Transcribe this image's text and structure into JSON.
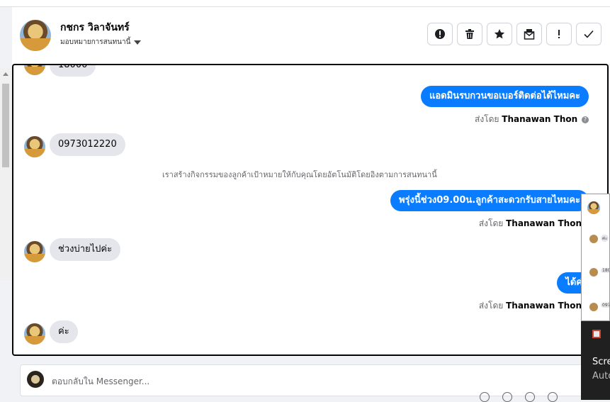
{
  "header": {
    "contact_name": "กชกร วิลาจันทร์",
    "assign_label": "มอบหมายการสนทนานี้",
    "actions": [
      {
        "name": "report-button",
        "icon": "alert-circle-icon"
      },
      {
        "name": "delete-button",
        "icon": "trash-icon"
      },
      {
        "name": "star-button",
        "icon": "star-icon"
      },
      {
        "name": "mark-unread-button",
        "icon": "envelope-icon"
      },
      {
        "name": "priority-button",
        "icon": "exclamation-icon"
      },
      {
        "name": "done-button",
        "icon": "checkmark-icon"
      }
    ]
  },
  "messages": {
    "partial_top": "18000",
    "out_1": "แอดมินรบกวนขอเบอร์ติดต่อได้ไหมคะ",
    "in_1": "0973012220",
    "system": "เราสร้างกิจกรรมของลูกค้าเป้าหมายให้กับคุณโดยอัตโนมัติโดยอิงตามการสนทนานี้",
    "out_2": "พรุ่งนี้ช่วง09.00น.ลูกค้าสะดวกรับสายไหมคะ",
    "in_2": "ช่วงบ่ายไปค่ะ",
    "out_3": "ได้ค่ะ",
    "in_3": "ค่ะ",
    "sent_by_prefix": "ส่งโดย",
    "sender": "Thanawan Thon"
  },
  "reply": {
    "placeholder": "ตอบกลับใน Messenger..."
  },
  "overlay": {
    "preview_1": "180",
    "preview_2": "097",
    "preview_3": "ค่ะ",
    "popup_title": "Scre",
    "popup_sub": "Auto"
  },
  "colors": {
    "outgoing_bubble": "#0a7cff",
    "incoming_bubble": "#e4e6eb"
  }
}
